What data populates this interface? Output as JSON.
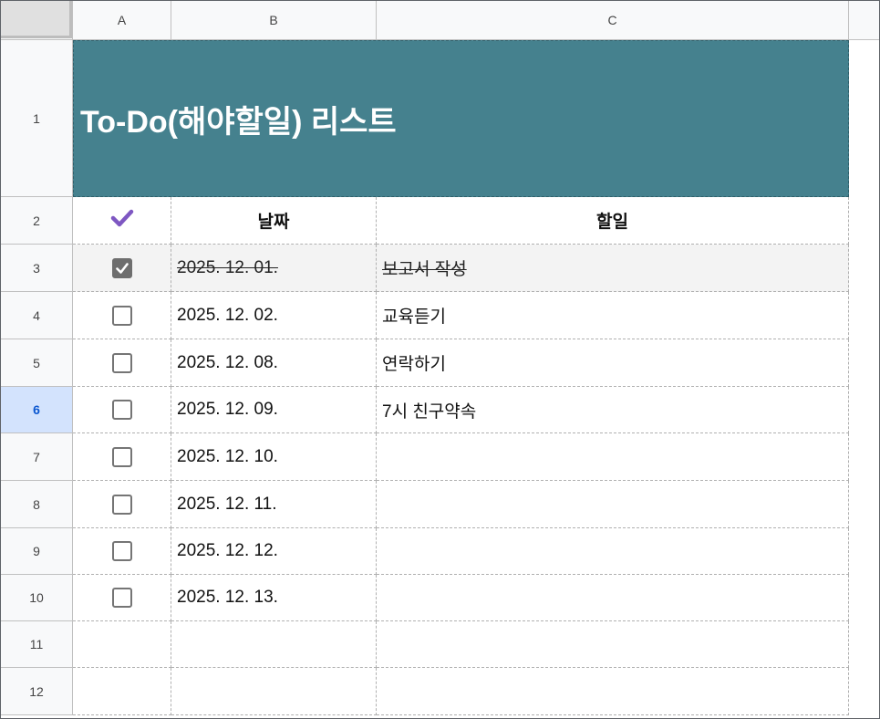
{
  "columns": [
    "A",
    "B",
    "C"
  ],
  "rows": [
    "1",
    "2",
    "3",
    "4",
    "5",
    "6",
    "7",
    "8",
    "9",
    "10",
    "11",
    "12"
  ],
  "active_row": "6",
  "title": "To-Do(해야할일) 리스트",
  "header": {
    "check_icon": "check-icon",
    "date": "날짜",
    "task": "할일"
  },
  "accent_color": "#45818e",
  "check_color": "#7e57c2",
  "items": [
    {
      "checked": true,
      "date": "2025. 12. 01.",
      "task": "보고서 작성"
    },
    {
      "checked": false,
      "date": "2025. 12. 02.",
      "task": "교육듣기"
    },
    {
      "checked": false,
      "date": "2025. 12. 08.",
      "task": "연락하기"
    },
    {
      "checked": false,
      "date": "2025. 12. 09.",
      "task": "7시 친구약속"
    },
    {
      "checked": false,
      "date": "2025. 12. 10.",
      "task": ""
    },
    {
      "checked": false,
      "date": "2025. 12. 11.",
      "task": ""
    },
    {
      "checked": false,
      "date": "2025. 12. 12.",
      "task": ""
    },
    {
      "checked": false,
      "date": "2025. 12. 13.",
      "task": ""
    }
  ]
}
